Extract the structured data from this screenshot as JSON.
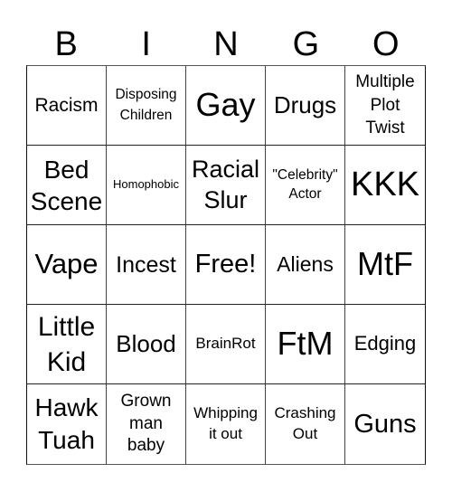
{
  "header": {
    "letters": [
      "B",
      "I",
      "N",
      "G",
      "O"
    ]
  },
  "cells": [
    {
      "label": "Racism"
    },
    {
      "label": "Disposing Children"
    },
    {
      "label": "Gay"
    },
    {
      "label": "Drugs"
    },
    {
      "label": "Multiple Plot Twist"
    },
    {
      "label": "Bed Scene"
    },
    {
      "label": "Homophobic"
    },
    {
      "label": "Racial Slur"
    },
    {
      "label": "\"Celebrity\" Actor"
    },
    {
      "label": "KKK"
    },
    {
      "label": "Vape"
    },
    {
      "label": "Incest"
    },
    {
      "label": "Free!"
    },
    {
      "label": "Aliens"
    },
    {
      "label": "MtF"
    },
    {
      "label": "Little Kid"
    },
    {
      "label": "Blood"
    },
    {
      "label": "BrainRot"
    },
    {
      "label": "FtM"
    },
    {
      "label": "Edging"
    },
    {
      "label": "Hawk Tuah"
    },
    {
      "label": "Grown man baby"
    },
    {
      "label": "Whipping it out"
    },
    {
      "label": "Crashing Out"
    },
    {
      "label": "Guns"
    }
  ]
}
